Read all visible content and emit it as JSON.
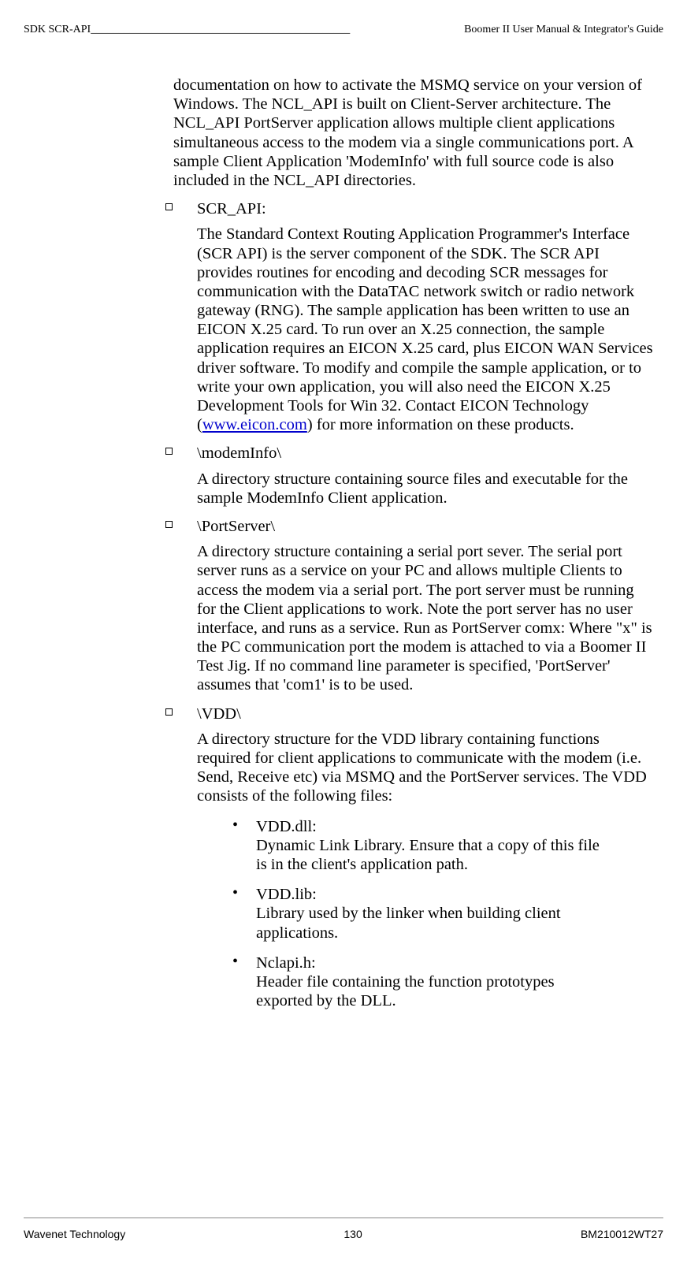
{
  "header": {
    "left": "SDK SCR-API",
    "line": " _______________________________________________ ",
    "right": "Boomer II User Manual & Integrator's Guide"
  },
  "intro_para": "documentation on how to activate the MSMQ service on your version of Windows. The NCL_API is built on Client-Server architecture. The NCL_API PortServer application allows multiple client applications simultaneous access to the modem via a single communications port. A sample Client Application 'ModemInfo' with full source code is also included in the NCL_API directories.",
  "items": [
    {
      "label": "SCR_API:",
      "body_pre": "The Standard Context Routing Application Programmer's Interface (SCR API) is the server component of the SDK. The SCR API provides routines for encoding and decoding SCR messages for communication with the DataTAC network switch or radio network gateway (RNG). The sample application has been written to use an EICON X.25 card. To run over an X.25 connection, the sample application requires an EICON X.25 card, plus EICON WAN Services driver software. To modify and compile the sample application, or to write your own application, you will also need the EICON X.25 Development Tools for Win 32. Contact EICON Technology (",
      "link": "www.eicon.com",
      "body_post": ") for more information on these products."
    },
    {
      "label": "\\modemInfo\\",
      "body": "A directory structure containing source files and executable for the sample ModemInfo Client application."
    },
    {
      "label": "\\PortServer\\",
      "body": "A directory structure containing a serial port sever. The serial port server runs as a service on your PC and allows multiple Clients to access the modem via a serial port. The port server must be running for the Client applications to work. Note the port server has no user interface, and runs as a service. Run as PortServer comx:  Where \"x\" is the PC communication port the modem is attached to via a Boomer II Test Jig. If no command line parameter is specified, 'PortServer' assumes that  'com1' is to be used."
    },
    {
      "label": "\\VDD\\",
      "body": "A directory structure for the VDD library containing functions required for client applications to communicate with the modem (i.e. Send, Receive etc) via MSMQ and the PortServer services. The VDD consists of the following files:",
      "subs": [
        {
          "label": "VDD.dll:",
          "desc": "Dynamic Link Library. Ensure that a copy of this file is in the client's application path."
        },
        {
          "label": "VDD.lib:",
          "desc": "Library used by the linker when building client applications."
        },
        {
          "label": "Nclapi.h:",
          "desc": "Header file containing the function prototypes exported by the DLL."
        }
      ]
    }
  ],
  "footer": {
    "left": "Wavenet Technology",
    "center": "130",
    "right": "BM210012WT27"
  }
}
